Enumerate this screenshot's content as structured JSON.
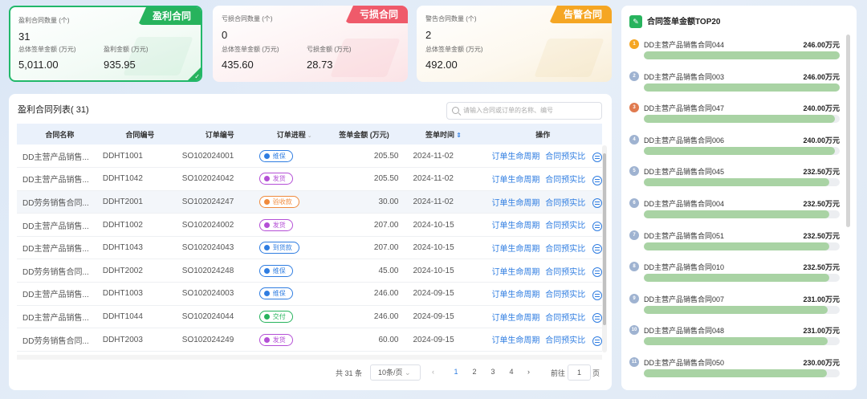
{
  "cards": {
    "profit": {
      "tag": "盈利合同",
      "count_label": "盈利合同数量 (个)",
      "count": "31",
      "total_label": "总体签单金额 (万元)",
      "total": "5,011.00",
      "profit_label": "盈利金额 (万元)",
      "profit": "935.95"
    },
    "loss": {
      "tag": "亏损合同",
      "count_label": "亏损合同数量 (个)",
      "count": "0",
      "total_label": "总体签单金额 (万元)",
      "total": "435.60",
      "loss_label": "亏损金额 (万元)",
      "loss": "28.73"
    },
    "warn": {
      "tag": "告警合同",
      "count_label": "警告合同数量 (个)",
      "count": "2",
      "total_label": "总体签单金额 (万元)",
      "total": "492.00"
    }
  },
  "list": {
    "title": "盈利合同列表( 31)",
    "search_placeholder": "请输入合同或订单的名称、编号",
    "columns": [
      "合同名称",
      "合同编号",
      "订单编号",
      "订单进程",
      "签单金额 (万元)",
      "签单时间",
      "操作"
    ],
    "op_labels": {
      "lifecycle": "订单生命周期",
      "forecast": "合同预实比"
    },
    "rows": [
      {
        "name": "DD主营产品销售...",
        "no": "DDHT1001",
        "order": "SO102024001",
        "status": "维保",
        "status_color": "#2f7de1",
        "amount": "205.50",
        "date": "2024-11-02"
      },
      {
        "name": "DD主营产品销售...",
        "no": "DDHT1042",
        "order": "SO102024042",
        "status": "发货",
        "status_color": "#b44fd6",
        "amount": "205.50",
        "date": "2024-11-02"
      },
      {
        "name": "DD劳务销售合同...",
        "no": "DDHT2001",
        "order": "SO102024247",
        "status": "验收款",
        "status_color": "#f08a3c",
        "amount": "30.00",
        "date": "2024-11-02"
      },
      {
        "name": "DD主营产品销售...",
        "no": "DDHT1002",
        "order": "SO102024002",
        "status": "发货",
        "status_color": "#b44fd6",
        "amount": "207.00",
        "date": "2024-10-15"
      },
      {
        "name": "DD主营产品销售...",
        "no": "DDHT1043",
        "order": "SO102024043",
        "status": "到货款",
        "status_color": "#2f7de1",
        "amount": "207.00",
        "date": "2024-10-15"
      },
      {
        "name": "DD劳务销售合同...",
        "no": "DDHT2002",
        "order": "SO102024248",
        "status": "维保",
        "status_color": "#2f7de1",
        "amount": "45.00",
        "date": "2024-10-15"
      },
      {
        "name": "DD主营产品销售...",
        "no": "DDHT1003",
        "order": "SO102024003",
        "status": "维保",
        "status_color": "#2f7de1",
        "amount": "246.00",
        "date": "2024-09-15"
      },
      {
        "name": "DD主营产品销售...",
        "no": "DDHT1044",
        "order": "SO102024044",
        "status": "交付",
        "status_color": "#27b35d",
        "amount": "246.00",
        "date": "2024-09-15"
      },
      {
        "name": "DD劳务销售合同...",
        "no": "DDHT2003",
        "order": "SO102024249",
        "status": "发货",
        "status_color": "#b44fd6",
        "amount": "60.00",
        "date": "2024-09-15"
      }
    ],
    "pager": {
      "total": "共 31 条",
      "page_size": "10条/页",
      "pages": [
        "1",
        "2",
        "3",
        "4"
      ],
      "current": "1",
      "goto_label": "前往",
      "goto_value": "1",
      "page_unit": "页"
    }
  },
  "top20": {
    "title": "合同签单金额TOP20",
    "max": 246.0,
    "items": [
      {
        "rank": "1",
        "name": "DD主营产品销售合同044",
        "amount": "246.00万元",
        "value": 246.0,
        "badge": "#f5a623"
      },
      {
        "rank": "2",
        "name": "DD主营产品销售合同003",
        "amount": "246.00万元",
        "value": 246.0,
        "badge": "#9fb3d1"
      },
      {
        "rank": "3",
        "name": "DD主营产品销售合同047",
        "amount": "240.00万元",
        "value": 240.0,
        "badge": "#e07a4f"
      },
      {
        "rank": "4",
        "name": "DD主营产品销售合同006",
        "amount": "240.00万元",
        "value": 240.0,
        "badge": "#9fb3d1"
      },
      {
        "rank": "5",
        "name": "DD主营产品销售合同045",
        "amount": "232.50万元",
        "value": 232.5,
        "badge": "#9fb3d1"
      },
      {
        "rank": "6",
        "name": "DD主营产品销售合同004",
        "amount": "232.50万元",
        "value": 232.5,
        "badge": "#9fb3d1"
      },
      {
        "rank": "7",
        "name": "DD主营产品销售合同051",
        "amount": "232.50万元",
        "value": 232.5,
        "badge": "#9fb3d1"
      },
      {
        "rank": "8",
        "name": "DD主营产品销售合同010",
        "amount": "232.50万元",
        "value": 232.5,
        "badge": "#9fb3d1"
      },
      {
        "rank": "9",
        "name": "DD主营产品销售合同007",
        "amount": "231.00万元",
        "value": 231.0,
        "badge": "#9fb3d1"
      },
      {
        "rank": "10",
        "name": "DD主营产品销售合同048",
        "amount": "231.00万元",
        "value": 231.0,
        "badge": "#9fb3d1"
      },
      {
        "rank": "11",
        "name": "DD主营产品销售合同050",
        "amount": "230.00万元",
        "value": 230.0,
        "badge": "#9fb3d1"
      }
    ]
  }
}
